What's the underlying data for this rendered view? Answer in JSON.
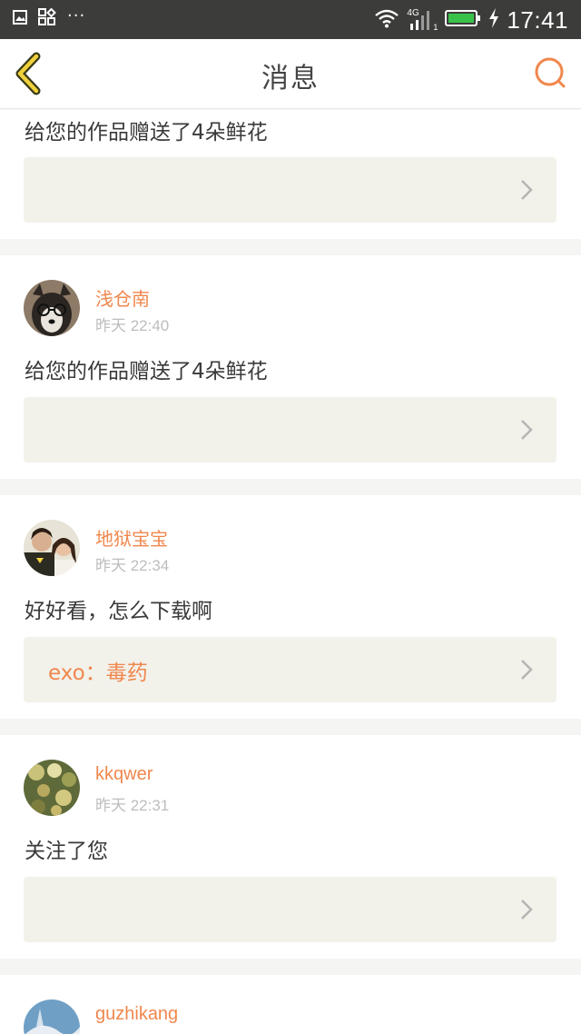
{
  "status_bar": {
    "dots": "···",
    "network": "4G",
    "sim": "1",
    "time": "17:41"
  },
  "header": {
    "title": "消息"
  },
  "colors": {
    "accent": "#f0874d",
    "card_ref_bg": "#f2f1ea",
    "page_bg": "#f5f5f3",
    "status_bar_bg": "#3c3d3b"
  },
  "messages": [
    {
      "message": "给您的作品赠送了4朵鲜花",
      "ref": ""
    },
    {
      "user": "浅仓南",
      "time": "昨天 22:40",
      "message": "给您的作品赠送了4朵鲜花",
      "ref": ""
    },
    {
      "user": "地狱宝宝",
      "time": "昨天 22:34",
      "message": "好好看，怎么下载啊",
      "ref": "exo：毒药"
    },
    {
      "user": "kkqwer",
      "time": "昨天 22:31",
      "message": "关注了您",
      "ref": ""
    },
    {
      "user": "guzhikang"
    }
  ]
}
